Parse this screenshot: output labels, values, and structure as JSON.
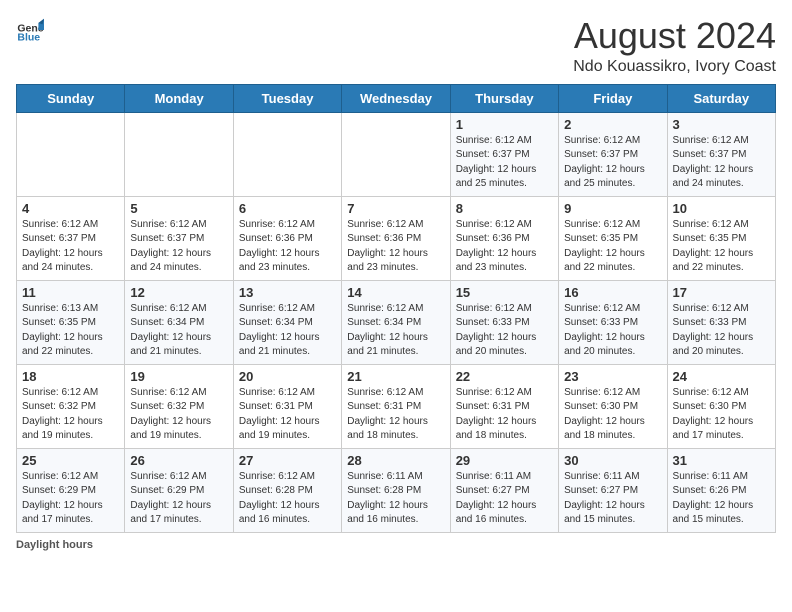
{
  "header": {
    "logo_general": "General",
    "logo_blue": "Blue",
    "title": "August 2024",
    "subtitle": "Ndo Kouassikro, Ivory Coast"
  },
  "weekdays": [
    "Sunday",
    "Monday",
    "Tuesday",
    "Wednesday",
    "Thursday",
    "Friday",
    "Saturday"
  ],
  "weeks": [
    [
      {
        "day": "",
        "info": ""
      },
      {
        "day": "",
        "info": ""
      },
      {
        "day": "",
        "info": ""
      },
      {
        "day": "",
        "info": ""
      },
      {
        "day": "1",
        "info": "Sunrise: 6:12 AM\nSunset: 6:37 PM\nDaylight: 12 hours\nand 25 minutes."
      },
      {
        "day": "2",
        "info": "Sunrise: 6:12 AM\nSunset: 6:37 PM\nDaylight: 12 hours\nand 25 minutes."
      },
      {
        "day": "3",
        "info": "Sunrise: 6:12 AM\nSunset: 6:37 PM\nDaylight: 12 hours\nand 24 minutes."
      }
    ],
    [
      {
        "day": "4",
        "info": "Sunrise: 6:12 AM\nSunset: 6:37 PM\nDaylight: 12 hours\nand 24 minutes."
      },
      {
        "day": "5",
        "info": "Sunrise: 6:12 AM\nSunset: 6:37 PM\nDaylight: 12 hours\nand 24 minutes."
      },
      {
        "day": "6",
        "info": "Sunrise: 6:12 AM\nSunset: 6:36 PM\nDaylight: 12 hours\nand 23 minutes."
      },
      {
        "day": "7",
        "info": "Sunrise: 6:12 AM\nSunset: 6:36 PM\nDaylight: 12 hours\nand 23 minutes."
      },
      {
        "day": "8",
        "info": "Sunrise: 6:12 AM\nSunset: 6:36 PM\nDaylight: 12 hours\nand 23 minutes."
      },
      {
        "day": "9",
        "info": "Sunrise: 6:12 AM\nSunset: 6:35 PM\nDaylight: 12 hours\nand 22 minutes."
      },
      {
        "day": "10",
        "info": "Sunrise: 6:12 AM\nSunset: 6:35 PM\nDaylight: 12 hours\nand 22 minutes."
      }
    ],
    [
      {
        "day": "11",
        "info": "Sunrise: 6:13 AM\nSunset: 6:35 PM\nDaylight: 12 hours\nand 22 minutes."
      },
      {
        "day": "12",
        "info": "Sunrise: 6:12 AM\nSunset: 6:34 PM\nDaylight: 12 hours\nand 21 minutes."
      },
      {
        "day": "13",
        "info": "Sunrise: 6:12 AM\nSunset: 6:34 PM\nDaylight: 12 hours\nand 21 minutes."
      },
      {
        "day": "14",
        "info": "Sunrise: 6:12 AM\nSunset: 6:34 PM\nDaylight: 12 hours\nand 21 minutes."
      },
      {
        "day": "15",
        "info": "Sunrise: 6:12 AM\nSunset: 6:33 PM\nDaylight: 12 hours\nand 20 minutes."
      },
      {
        "day": "16",
        "info": "Sunrise: 6:12 AM\nSunset: 6:33 PM\nDaylight: 12 hours\nand 20 minutes."
      },
      {
        "day": "17",
        "info": "Sunrise: 6:12 AM\nSunset: 6:33 PM\nDaylight: 12 hours\nand 20 minutes."
      }
    ],
    [
      {
        "day": "18",
        "info": "Sunrise: 6:12 AM\nSunset: 6:32 PM\nDaylight: 12 hours\nand 19 minutes."
      },
      {
        "day": "19",
        "info": "Sunrise: 6:12 AM\nSunset: 6:32 PM\nDaylight: 12 hours\nand 19 minutes."
      },
      {
        "day": "20",
        "info": "Sunrise: 6:12 AM\nSunset: 6:31 PM\nDaylight: 12 hours\nand 19 minutes."
      },
      {
        "day": "21",
        "info": "Sunrise: 6:12 AM\nSunset: 6:31 PM\nDaylight: 12 hours\nand 18 minutes."
      },
      {
        "day": "22",
        "info": "Sunrise: 6:12 AM\nSunset: 6:31 PM\nDaylight: 12 hours\nand 18 minutes."
      },
      {
        "day": "23",
        "info": "Sunrise: 6:12 AM\nSunset: 6:30 PM\nDaylight: 12 hours\nand 18 minutes."
      },
      {
        "day": "24",
        "info": "Sunrise: 6:12 AM\nSunset: 6:30 PM\nDaylight: 12 hours\nand 17 minutes."
      }
    ],
    [
      {
        "day": "25",
        "info": "Sunrise: 6:12 AM\nSunset: 6:29 PM\nDaylight: 12 hours\nand 17 minutes."
      },
      {
        "day": "26",
        "info": "Sunrise: 6:12 AM\nSunset: 6:29 PM\nDaylight: 12 hours\nand 17 minutes."
      },
      {
        "day": "27",
        "info": "Sunrise: 6:12 AM\nSunset: 6:28 PM\nDaylight: 12 hours\nand 16 minutes."
      },
      {
        "day": "28",
        "info": "Sunrise: 6:11 AM\nSunset: 6:28 PM\nDaylight: 12 hours\nand 16 minutes."
      },
      {
        "day": "29",
        "info": "Sunrise: 6:11 AM\nSunset: 6:27 PM\nDaylight: 12 hours\nand 16 minutes."
      },
      {
        "day": "30",
        "info": "Sunrise: 6:11 AM\nSunset: 6:27 PM\nDaylight: 12 hours\nand 15 minutes."
      },
      {
        "day": "31",
        "info": "Sunrise: 6:11 AM\nSunset: 6:26 PM\nDaylight: 12 hours\nand 15 minutes."
      }
    ]
  ],
  "footer": {
    "label": "Daylight hours"
  }
}
